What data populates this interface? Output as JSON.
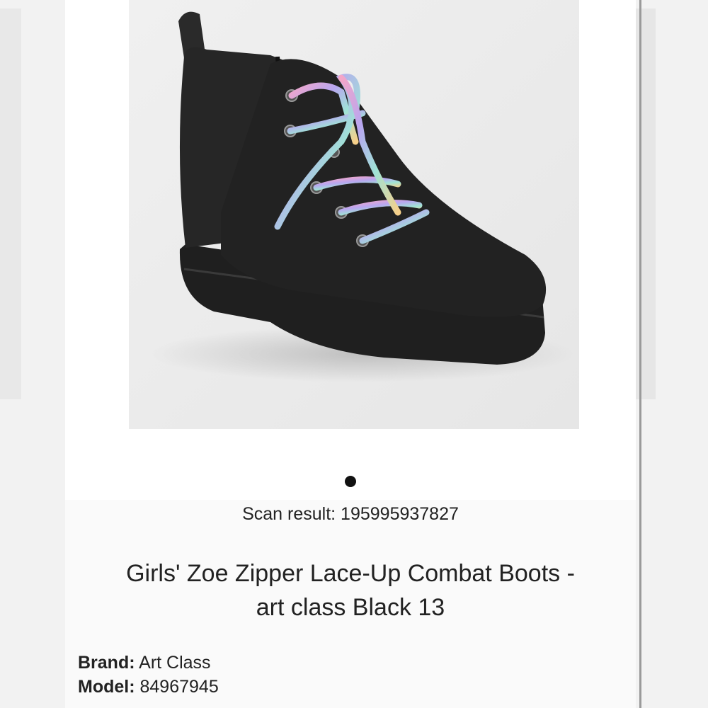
{
  "product": {
    "image_alt": "Black lace-up combat boot with rainbow laces",
    "carousel_total": 1,
    "carousel_active": 1
  },
  "scan": {
    "label": "Scan result:",
    "value": "195995937827"
  },
  "title_line1": "Girls' Zoe Zipper Lace-Up Combat Boots -",
  "title_line2": "art class Black 13",
  "details": {
    "brand_label": "Brand:",
    "brand_value": "Art Class",
    "model_label": "Model:",
    "model_value": "84967945"
  }
}
